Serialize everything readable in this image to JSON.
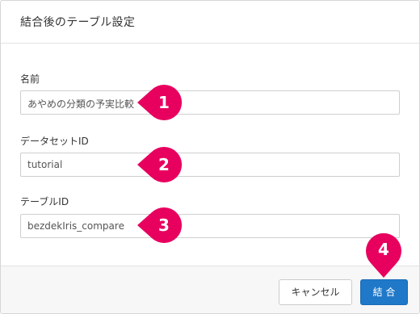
{
  "dialog": {
    "title": "結合後のテーブル設定"
  },
  "fields": [
    {
      "label": "名前",
      "value": "あやめの分類の予実比較"
    },
    {
      "label": "データセットID",
      "value": "tutorial"
    },
    {
      "label": "テーブルID",
      "value": "bezdekIris_compare"
    }
  ],
  "footer": {
    "cancel_label": "キャンセル",
    "submit_label": "結 合"
  },
  "markers": [
    "1",
    "2",
    "3",
    "4"
  ],
  "colors": {
    "accent": "#1f78c8",
    "marker": "#e8005f"
  }
}
